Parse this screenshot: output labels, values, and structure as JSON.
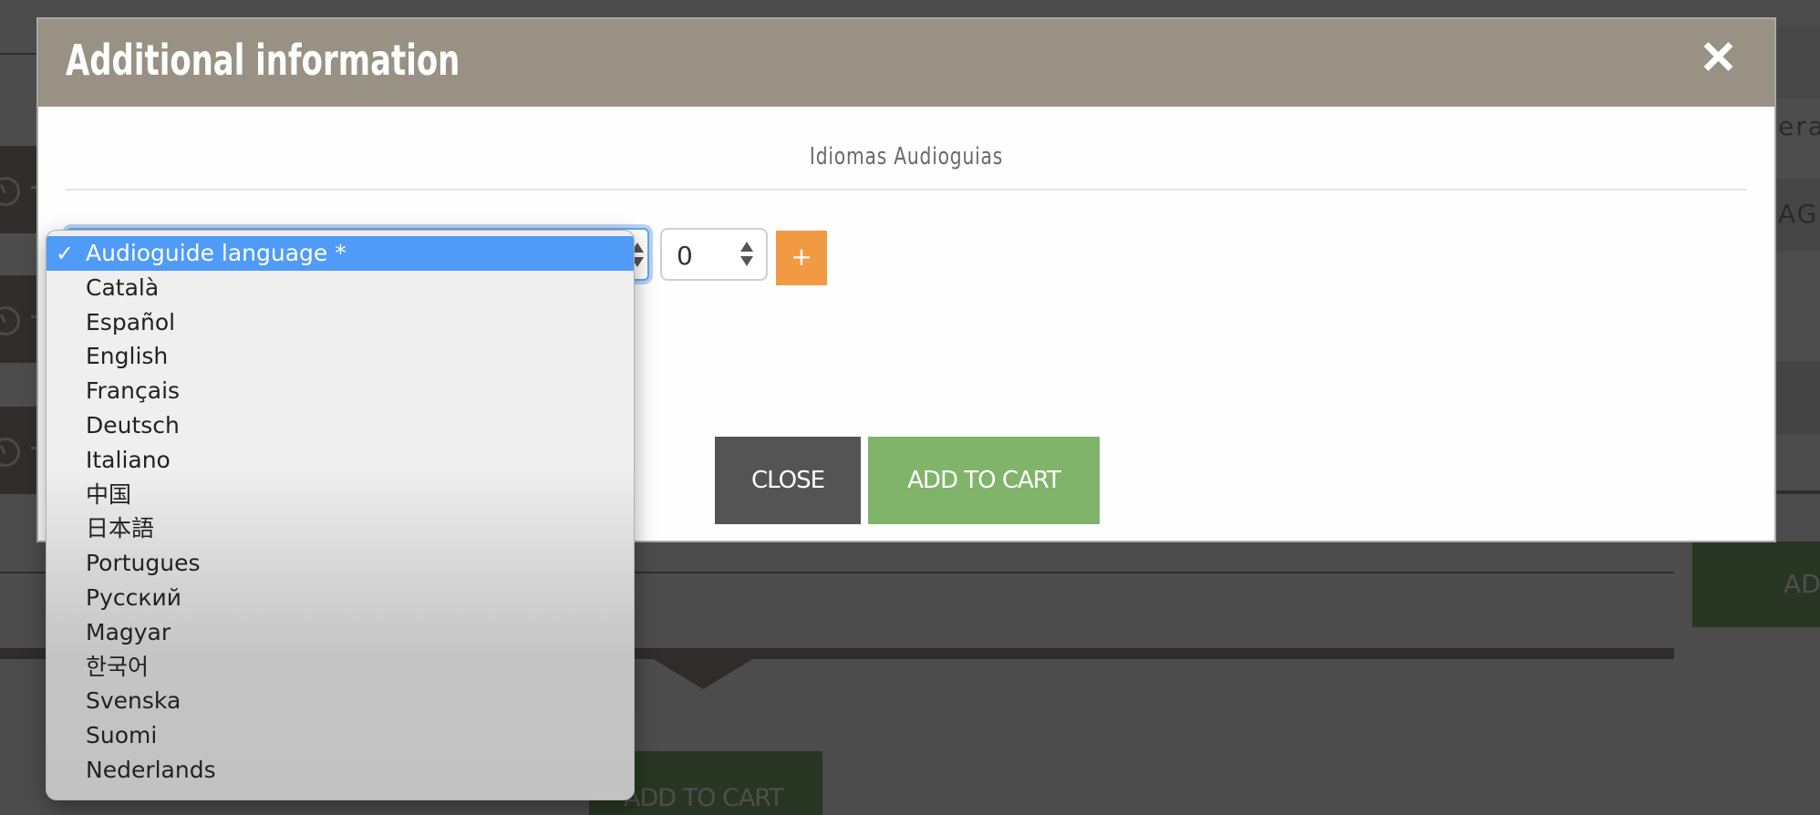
{
  "background": {
    "right_text_1": "era",
    "right_text_2": "AGI",
    "right_cart_label": "AD",
    "cart_label": "ADD TO CART"
  },
  "modal": {
    "title": "Additional information",
    "close_icon": "close-icon",
    "section_title": "Idiomas Audioguias",
    "language_select": {
      "selected": "Audioguide language *",
      "options": [
        "Audioguide language *",
        "Català",
        "Español",
        "English",
        "Français",
        "Deutsch",
        "Italiano",
        "中国",
        "日本語",
        "Portugues",
        "Русский",
        "Magyar",
        "한국어",
        "Svenska",
        "Suomi",
        "Nederlands"
      ]
    },
    "quantity": "0",
    "plus_label": "+",
    "close_label": "CLOSE",
    "add_to_cart_label": "ADD TO CART"
  },
  "colors": {
    "header": "#989184",
    "plus_button": "#f29a43",
    "add_to_cart": "#80b46a",
    "close_button": "#545454",
    "selected_option": "#4f9bf7"
  }
}
